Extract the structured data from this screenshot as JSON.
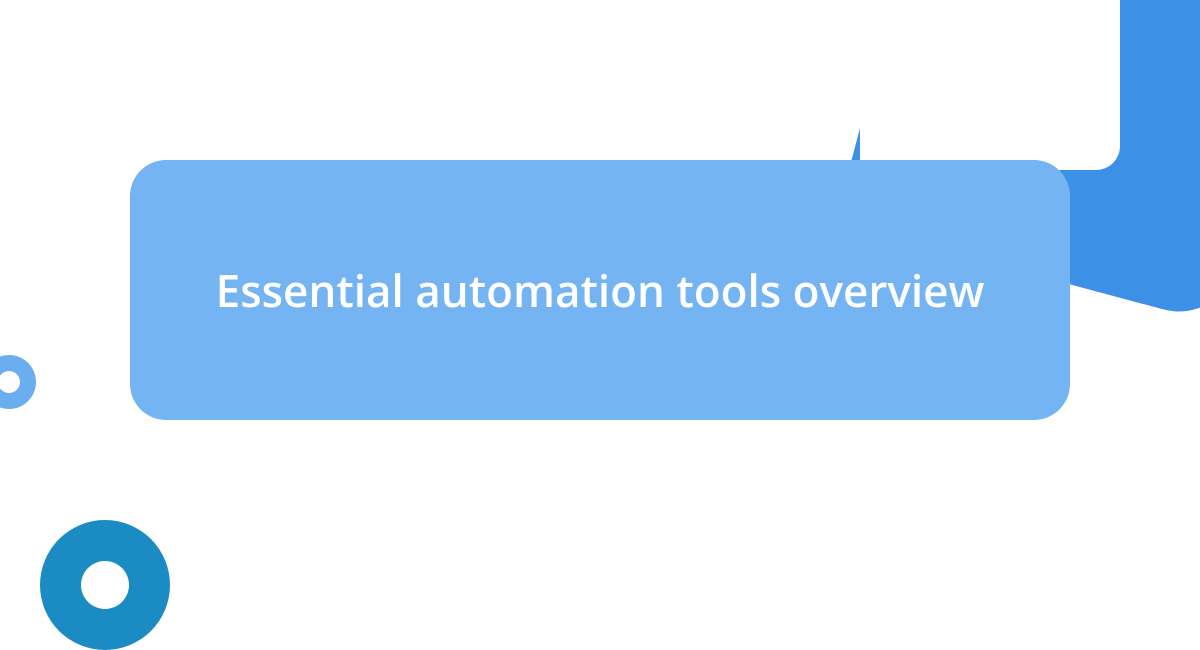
{
  "title": "Essential automation tools overview",
  "colors": {
    "card": "#75b4f2",
    "shape_top": "#3c91e6",
    "ring_small": "#6aaef0",
    "ring_large": "#1b8bc4"
  }
}
